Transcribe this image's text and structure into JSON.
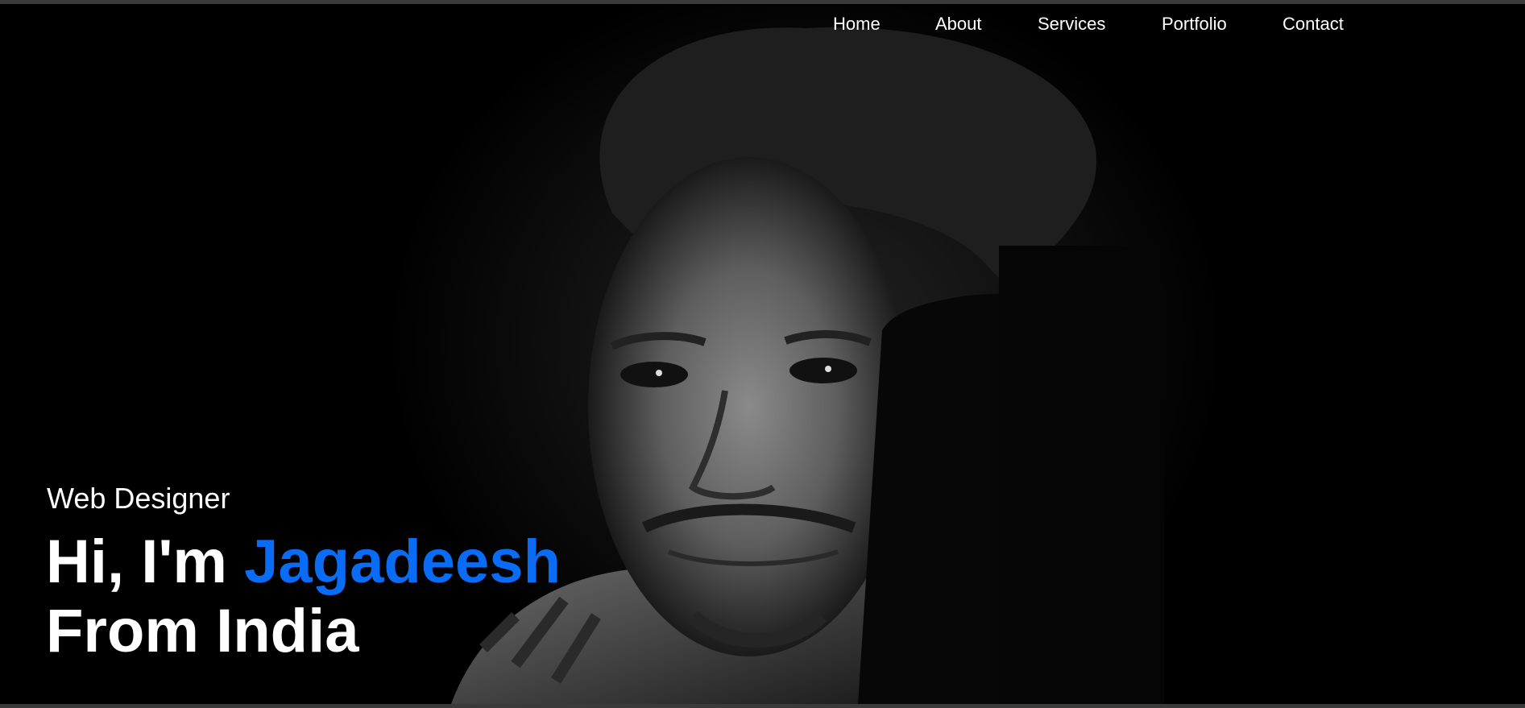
{
  "nav": {
    "items": [
      {
        "label": "Home"
      },
      {
        "label": "About"
      },
      {
        "label": "Services"
      },
      {
        "label": "Portfolio"
      },
      {
        "label": "Contact"
      }
    ]
  },
  "hero": {
    "subtitle": "Web Designer",
    "greeting": "Hi, I'm",
    "name": "Jagadeesh",
    "location_line": "From India",
    "accent_color": "#0a6cf5",
    "background_color": "#000000",
    "text_color": "#ffffff"
  }
}
